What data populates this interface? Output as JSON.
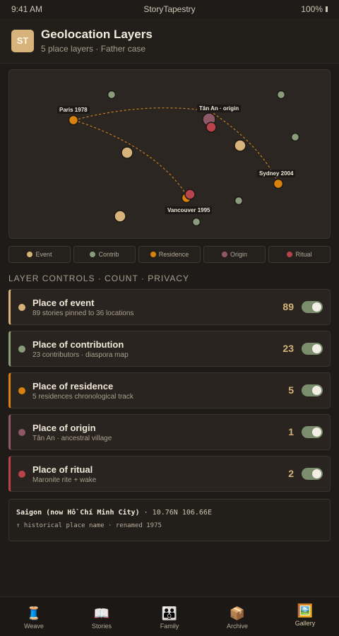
{
  "status": {
    "time": "9:41 AM",
    "app": "StoryTapestry",
    "battery": "100%"
  },
  "header": {
    "avatar": "ST",
    "title": "Geolocation Layers",
    "subtitle": "5 place layers · Father case"
  },
  "colors": {
    "event": "#d7b27a",
    "contribution": "#8b9c7c",
    "residence": "#d7820f",
    "origin": "#8e5868",
    "ritual": "#b8434a"
  },
  "map": {
    "labels": {
      "paris": "Paris 1978",
      "tanan": "Tân An · origin",
      "sydney": "Sydney 2004",
      "vancouver": "Vancouver 1995"
    }
  },
  "legend": [
    {
      "label": "Event",
      "color": "#d7b27a"
    },
    {
      "label": "Contrib",
      "color": "#8b9c7c"
    },
    {
      "label": "Residence",
      "color": "#d7820f"
    },
    {
      "label": "Origin",
      "color": "#8e5868"
    },
    {
      "label": "Ritual",
      "color": "#b8434a"
    }
  ],
  "section_title": "LAYER CONTROLS · COUNT · PRIVACY",
  "layers": [
    {
      "name": "Place of event",
      "sub": "89 stories pinned to 36 locations",
      "count": "89",
      "color": "#d7b27a",
      "enabled": true
    },
    {
      "name": "Place of contribution",
      "sub": "23 contributors · diaspora map",
      "count": "23",
      "color": "#8b9c7c",
      "enabled": true
    },
    {
      "name": "Place of residence",
      "sub": "5 residences chronological track",
      "count": "5",
      "color": "#d7820f",
      "enabled": true
    },
    {
      "name": "Place of origin",
      "sub": "Tân An · ancestral village",
      "count": "1",
      "color": "#8e5868",
      "enabled": true
    },
    {
      "name": "Place of ritual",
      "sub": "Maronite rite + wake",
      "count": "2",
      "color": "#b8434a",
      "enabled": true
    }
  ],
  "place_info": {
    "name": "Saigon (now Hồ Chí Minh City)",
    "coords": " · 10.76N 106.66E",
    "note": "↑ historical place name · renamed 1975"
  },
  "tabs": [
    {
      "icon": "🧵",
      "label": "Weave",
      "name": "weave"
    },
    {
      "icon": "📖",
      "label": "Stories",
      "name": "stories"
    },
    {
      "icon": "👪",
      "label": "Family",
      "name": "family"
    },
    {
      "icon": "📦",
      "label": "Archive",
      "name": "archive"
    },
    {
      "icon": "🖼️",
      "label": "Gallery",
      "name": "gallery",
      "active": true
    }
  ]
}
